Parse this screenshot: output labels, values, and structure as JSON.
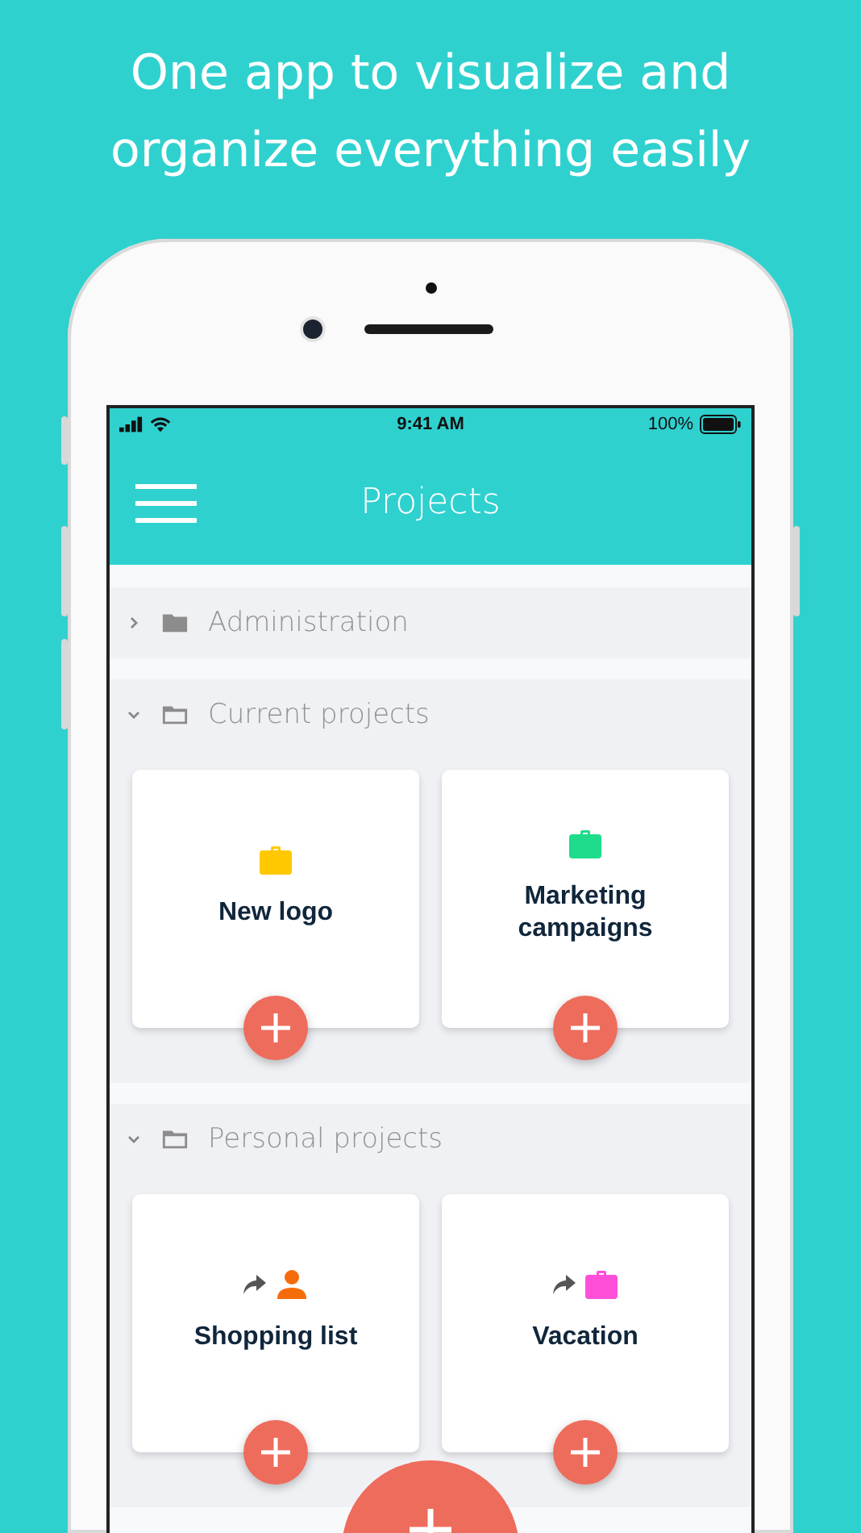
{
  "headline": "One app to visualize and organize everything easily",
  "status_bar": {
    "time": "9:41 AM",
    "battery": "100%"
  },
  "header": {
    "title": "Projects"
  },
  "folders": [
    {
      "name": "Administration",
      "expanded": false
    },
    {
      "name": "Current projects",
      "expanded": true,
      "projects": [
        {
          "title": "New logo",
          "kind": "briefcase",
          "color": "#ffc800",
          "shared": false
        },
        {
          "title": "Marketing campaigns",
          "kind": "briefcase",
          "color": "#1fdc8c",
          "shared": false
        }
      ]
    },
    {
      "name": "Personal projects",
      "expanded": true,
      "projects": [
        {
          "title": "Shopping list",
          "kind": "person",
          "color": "#f56c0a",
          "shared": true
        },
        {
          "title": "Vacation",
          "kind": "briefcase",
          "color": "#ff4fd8",
          "shared": true
        }
      ]
    }
  ]
}
